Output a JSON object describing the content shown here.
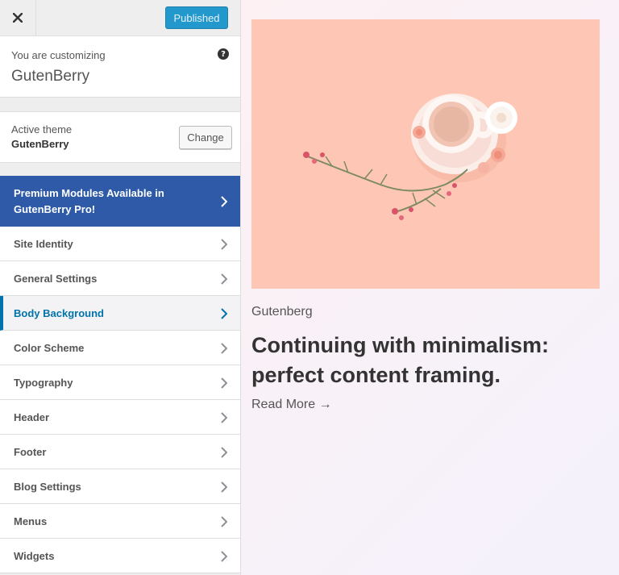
{
  "topbar": {
    "publish_label": "Published"
  },
  "info": {
    "customizing_label": "You are customizing",
    "site_name": "GutenBerry",
    "help_symbol": "?"
  },
  "theme": {
    "label": "Active theme",
    "name": "GutenBerry",
    "change_label": "Change"
  },
  "premium": {
    "label": "Premium Modules Available in GutenBerry Pro!"
  },
  "menu": {
    "items": [
      {
        "label": "Site Identity"
      },
      {
        "label": "General Settings"
      },
      {
        "label": "Body Background"
      },
      {
        "label": "Color Scheme"
      },
      {
        "label": "Typography"
      },
      {
        "label": "Header"
      },
      {
        "label": "Footer"
      },
      {
        "label": "Blog Settings"
      },
      {
        "label": "Menus"
      },
      {
        "label": "Widgets"
      }
    ]
  },
  "preview": {
    "category": "Gutenberg",
    "post_title": "Continuing with minimalism: perfect content framing.",
    "read_more": "Read More →"
  },
  "colors": {
    "accent": "#0073aa",
    "premium_bg": "#2f5aa8",
    "hero_bg": "#fec7b5"
  }
}
